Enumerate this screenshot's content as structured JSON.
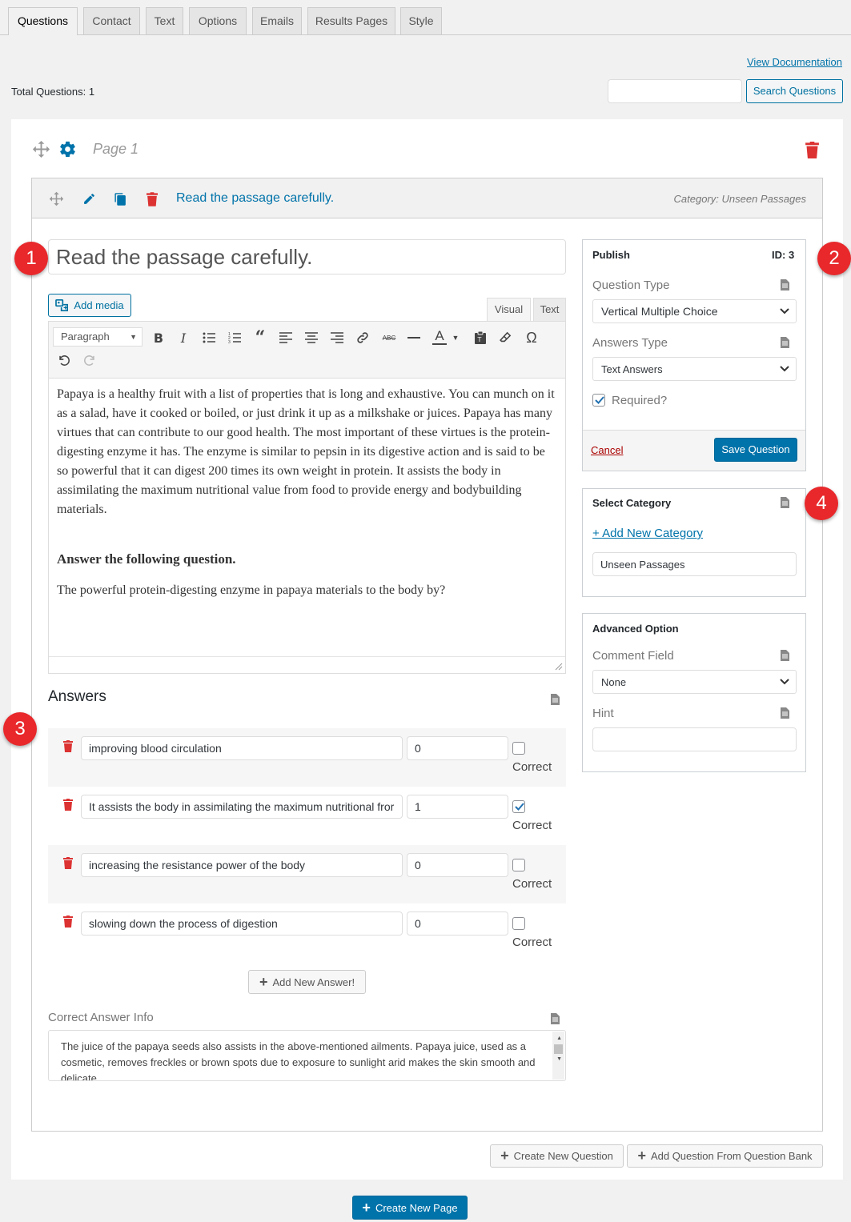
{
  "tabs": [
    "Questions",
    "Contact",
    "Text",
    "Options",
    "Emails",
    "Results Pages",
    "Style"
  ],
  "view_documentation": "View Documentation",
  "total_questions": "Total Questions: 1",
  "search": {
    "placeholder": "",
    "button": "Search Questions"
  },
  "page": {
    "title": "Page 1"
  },
  "question_header": {
    "title": "Read the passage carefully.",
    "category": "Category: Unseen Passages"
  },
  "question_title_value": "Read the passage carefully.",
  "editor": {
    "add_media": "Add media",
    "tab_visual": "Visual",
    "tab_text": "Text",
    "format": "Paragraph",
    "paragraph1": "Papaya is a healthy fruit with a list of properties that is long and exhaustive. You can munch on it as a salad, have it cooked or boiled, or just drink it up as a milkshake or juices. Papaya has many virtues that can contribute to our good health. The most important of these virtues is the protein-digesting enzyme it has. The enzyme is similar to pepsin in its digestive action and is said to be so powerful that it can digest 200 times its own weight in protein. It assists the body in assimilating the maximum nutritional value from food to provide energy and bodybuilding materials.",
    "heading": "Answer the following question.",
    "paragraph2": "The powerful protein-digesting enzyme in papaya materials to the body by?"
  },
  "answers": {
    "title": "Answers",
    "correct_label": "Correct",
    "items": [
      {
        "text": "improving blood circulation",
        "points": "0",
        "correct": false
      },
      {
        "text": "It assists the body in assimilating the maximum nutritional fror",
        "points": "1",
        "correct": true
      },
      {
        "text": "increasing the resistance power of the body",
        "points": "0",
        "correct": false
      },
      {
        "text": "slowing down the process of digestion",
        "points": "0",
        "correct": false
      }
    ],
    "add_button": "Add New Answer!"
  },
  "correct_answer_info": {
    "label": "Correct Answer Info",
    "value": "The juice of the papaya seeds also assists in the above-mentioned ailments. Papaya juice, used as a cosmetic, removes freckles or brown spots due to exposure to sunlight arid makes the skin smooth and delicate."
  },
  "publish": {
    "title": "Publish",
    "id": "ID: 3",
    "question_type_label": "Question Type",
    "question_type_value": "Vertical Multiple Choice",
    "answers_type_label": "Answers Type",
    "answers_type_value": "Text Answers",
    "required_label": "Required?",
    "cancel": "Cancel",
    "save": "Save Question"
  },
  "category": {
    "title": "Select Category",
    "add_new": "+ Add New Category",
    "value": "Unseen Passages"
  },
  "advanced": {
    "title": "Advanced Option",
    "comment_label": "Comment Field",
    "comment_value": "None",
    "hint_label": "Hint",
    "hint_value": ""
  },
  "bottom": {
    "create_question": "Create New Question",
    "add_from_bank": "Add Question From Question Bank",
    "create_page": "Create New Page"
  },
  "badges": [
    "1",
    "2",
    "3",
    "4"
  ],
  "colors": {
    "accent": "#0073aa",
    "delete": "#dc3232",
    "badge": "#e8282b"
  }
}
